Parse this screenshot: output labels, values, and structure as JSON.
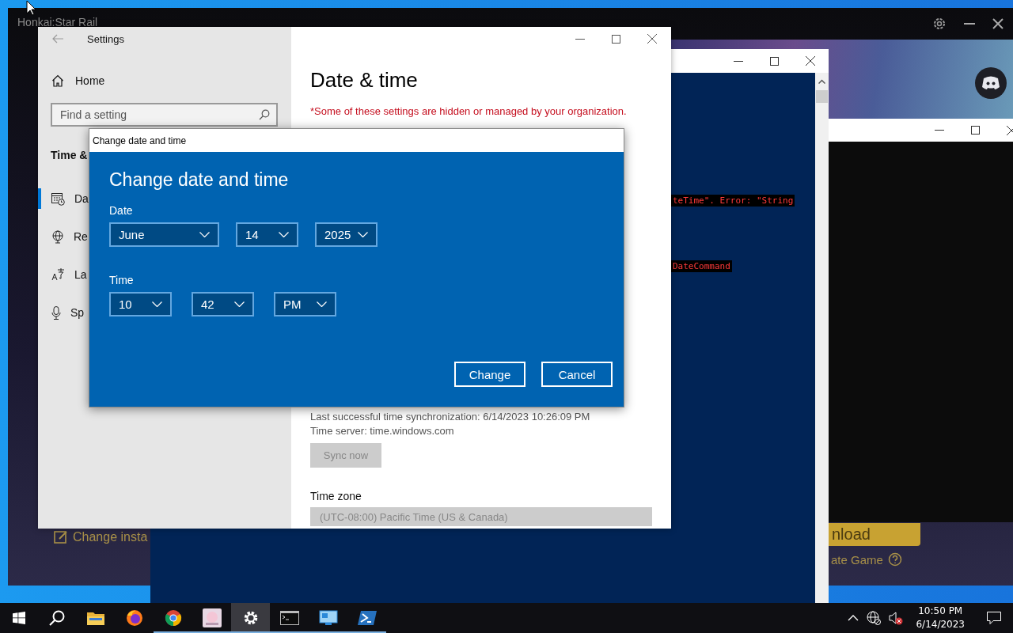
{
  "launcher": {
    "title": "Honkai:Star Rail",
    "install_link": "Change insta",
    "download_button": "nload",
    "repair_link": "ate Game"
  },
  "settings": {
    "title": "Settings",
    "home": "Home",
    "search": {
      "placeholder": "Find a setting"
    },
    "section": "Time &",
    "nav": [
      {
        "kind": "calendar",
        "label": "Da",
        "selected": true
      },
      {
        "kind": "globe",
        "label": "Re",
        "selected": false
      },
      {
        "kind": "language",
        "label": "La",
        "selected": false
      },
      {
        "kind": "mic",
        "label": "Sp",
        "selected": false
      }
    ],
    "heading": "Date & time",
    "notice": "*Some of these settings are hidden or managed by your organization.",
    "sync_info": [
      "Last successful time synchronization: 6/14/2023 10:26:09 PM",
      "Time server: time.windows.com"
    ],
    "sync_button": {
      "label": "Sync now",
      "disabled": true
    },
    "time_zone": {
      "label": "Time zone",
      "value": "(UTC-08:00) Pacific Time (US & Canada)",
      "disabled": true
    }
  },
  "dialog": {
    "title": "Change date and time",
    "heading": "Change date and time",
    "groups": [
      {
        "kind": "date",
        "label": "Date",
        "fields": [
          "June",
          "14",
          "2025"
        ]
      },
      {
        "kind": "time",
        "label": "Time",
        "fields": [
          "10",
          "42",
          "PM"
        ]
      }
    ],
    "buttons": [
      "Change",
      "Cancel"
    ]
  },
  "console": {
    "error_lines": [
      "teTime\". Error: \"String",
      "DateCommand"
    ]
  },
  "taskbar": {
    "apps": [
      {
        "kind": "folder",
        "running": false,
        "active": false
      },
      {
        "kind": "firefox",
        "running": false,
        "active": false
      },
      {
        "kind": "chrome",
        "running": true,
        "active": false
      },
      {
        "kind": "game",
        "running": true,
        "active": false
      },
      {
        "kind": "gear",
        "running": true,
        "active": true
      },
      {
        "kind": "terminal",
        "running": true,
        "active": false
      },
      {
        "kind": "remote",
        "running": true,
        "active": false
      },
      {
        "kind": "powershell",
        "running": true,
        "active": false
      }
    ],
    "clock": {
      "time": "10:50 PM",
      "date": "6/14/2023"
    }
  }
}
